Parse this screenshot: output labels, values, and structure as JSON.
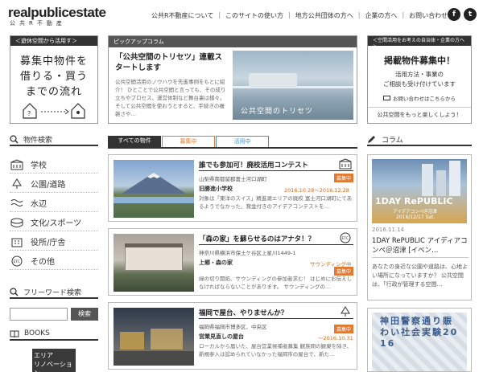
{
  "header": {
    "logo": "realpublicestate",
    "logo_sub": "公共R不動産",
    "nav": [
      "公共R不動産について",
      "このサイトの使い方",
      "地方公共団体の方へ",
      "企業の方へ",
      "お問い合わせ"
    ],
    "social": [
      "f",
      "t"
    ]
  },
  "left_promo": {
    "tag": "＜遊休空間から活用す＞",
    "text_lines": [
      "募集中物件を",
      "借りる・買う",
      "までの流れ"
    ]
  },
  "pickup": {
    "head": "ピックアップコラム",
    "title": "「公共空間のトリセツ」連載スタートします",
    "body": "公共空間活用のノウハウを先進事例をもとに紹介！ ひとことで公共空間と言っても、その成り立ちやプロセス、運営体制など舞台裏は様々。 そして公共空間を使おうとすると、手続きの複雑さや…",
    "image_caption": "公共空間のトリセツ"
  },
  "right_promo": {
    "tag": "＜空間活用をお考えの自治体・企業の方へ＞",
    "title": "掲載物件募集中！",
    "lines": [
      "活用方法・事業の",
      "ご相談も受け付けています"
    ],
    "contact": "お問い合わせはこちらから",
    "footer": "公共空間をもっと楽しくしよう！"
  },
  "sidebar": {
    "search_title": "物件検索",
    "categories": [
      "学校",
      "公園/道路",
      "水辺",
      "文化/スポーツ",
      "役所/庁舎",
      "その他"
    ],
    "freeword_title": "フリーワード検索",
    "search_button": "検索",
    "books_title": "BOOKS",
    "book_cover": [
      "エリア",
      "リノベーション"
    ]
  },
  "tabs": [
    "すべての物件",
    "募集中",
    "活用中"
  ],
  "cards": [
    {
      "title": "誰でも参加可！廃校活用コンテスト",
      "location": "山梨県南都留郡富士河口湖町",
      "name": "旧勝進小学校",
      "date": "2016.10.28〜2016.12.28",
      "badge": "募集中",
      "body": "対象は「東洋のスイス」精進湖エリアの廃校 富士河口湖町にてあるようでなかった、賞金付きのアイデアコンテストを…"
    },
    {
      "title": "「森の家」を蘇らせるのはアナタ！？",
      "location": "神奈川県横浜市保土ケ谷区上星川1449-1",
      "name": "上郷・森の家",
      "date": "サウンディング中",
      "badge": "募集中",
      "body": "緑の切り開拓、サウンディングの参加者求む！ はじめにお伝えしなければならないことがあります。 サウンディングの…"
    },
    {
      "title": "福岡で屋台、やりませんか？",
      "location": "福岡県福岡市博多区、中央区",
      "name": "営業見直しの屋台",
      "date": "〜2016.10.31",
      "badge": "募集中",
      "body": "ローカルから届いた、屋台営業候補者募集 観族問の観衆を除き、新規参入は認められていなかった福岡市の屋台で、新た…"
    }
  ],
  "column": {
    "title": "コラム",
    "item1": {
      "banner": "1DAY RePUBLIC",
      "banner_sub": "アイデアコンペ＠沼津",
      "banner_date": "2016/12/17 Sat.",
      "date": "2016.11.14",
      "title": "1DAY RePUBLIC アイディアコンペ＠沼津 [イベン…",
      "body": "あなたの身近な公園や道路は、心地よい場所になっていますか？ 公共空間は、「行政が管理する空間…"
    },
    "item2_text": "神田警察通り賑わい社会実験2016"
  },
  "colors": {
    "accent": "#e07a33",
    "dark": "#333333",
    "promo_red": "#c0392b"
  }
}
